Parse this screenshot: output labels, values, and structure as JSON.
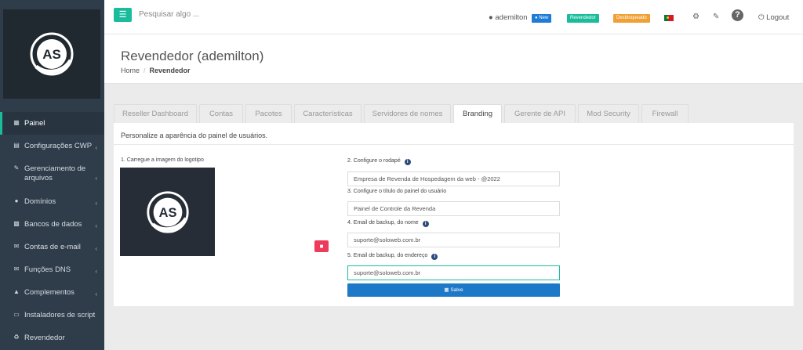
{
  "search": {
    "placeholder": "Pesquisar algo ..."
  },
  "topbar": {
    "username": "ademilton",
    "badges": {
      "new": "New",
      "reseller": "Revendedor",
      "unlocked": "Desbloqueado"
    },
    "logout_label": "Logout",
    "help_label": "?"
  },
  "sidebar": {
    "logo_text": "AS",
    "items": [
      {
        "label": "Painel",
        "icon": "grid-icon",
        "active": true
      },
      {
        "label": "Configurações CWP",
        "icon": "chart-icon"
      },
      {
        "label": "Gerenciamento de arquivos",
        "icon": "edit-icon"
      },
      {
        "label": "Domínios",
        "icon": "globe-icon"
      },
      {
        "label": "Bancos de dados",
        "icon": "database-icon"
      },
      {
        "label": "Contas de e-mail",
        "icon": "envelope-icon"
      },
      {
        "label": "Funções DNS",
        "icon": "envelope-icon"
      },
      {
        "label": "Complementos",
        "icon": "bank-icon"
      },
      {
        "label": "Instaladores de script",
        "icon": "monitor-icon"
      },
      {
        "label": "Revendedor",
        "icon": "recycle-icon"
      }
    ]
  },
  "page": {
    "title": "Revendedor (ademilton)",
    "breadcrumb": {
      "home": "Home",
      "current": "Revendedor"
    }
  },
  "tabs": [
    {
      "label": "Reseller Dashboard"
    },
    {
      "label": "Contas"
    },
    {
      "label": "Pacotes"
    },
    {
      "label": "Características"
    },
    {
      "label": "Servidores de nomes"
    },
    {
      "label": "Branding",
      "active": true
    },
    {
      "label": "Gerente de API"
    },
    {
      "label": "Mod Security"
    },
    {
      "label": "Firewall"
    }
  ],
  "branding": {
    "description": "Personalize a aparência do painel de usuários.",
    "logo_label": "1. Carregue a imagem do logotipo",
    "logo_text": "AS",
    "footer_label": "2. Configure o rodapé",
    "footer_value": "Empresa de Revenda de Hospedagem da web - @2022",
    "title_label": "3. Configure o título do painel do usuário",
    "title_value": "Painel de Controle da Revenda",
    "backup_name_label": "4. Email de backup, do nome",
    "backup_name_value": "suporte@soloweb.com.br",
    "backup_address_label": "5. Email de backup, do endereço",
    "backup_address_value": "suporte@soloweb.com.br",
    "save_label": "Salve",
    "info_glyph": "i"
  },
  "colors": {
    "accent": "#1abc9c",
    "sidebar_bg": "#2f3d4a",
    "save_button": "#1e78c8",
    "delete_button": "#ee3a5b",
    "badge_new": "#1e7bd6",
    "badge_unlocked": "#f0a034"
  }
}
